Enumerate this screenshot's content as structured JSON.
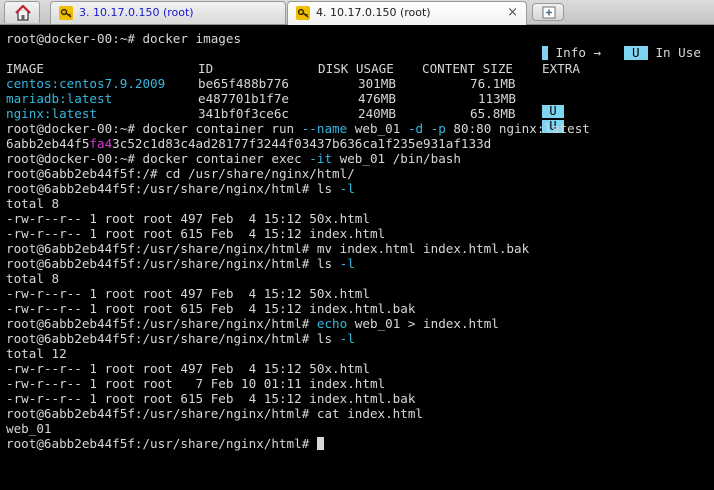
{
  "tabs": [
    {
      "label": "3. 10.17.0.150 (root)",
      "active": false
    },
    {
      "label": "4. 10.17.0.150 (root)",
      "active": true,
      "close": "×"
    }
  ],
  "colors": {
    "background": "#000000",
    "text": "#d7d7d7",
    "cyan": "#36b7e0",
    "badge": "#7fd4ef"
  },
  "legend": {
    "info": "Info →",
    "in_use_box": "U",
    "in_use_label": "In Use"
  },
  "terminal": {
    "line1": "root@docker-00:~# docker images",
    "header": {
      "repo": "IMAGE",
      "id": "ID",
      "disk": "DISK USAGE",
      "content": "CONTENT SIZE",
      "extra": "EXTRA"
    },
    "images": [
      {
        "name": "centos:centos7.9.2009",
        "id": "be65f488b776",
        "disk": "301MB",
        "content": "76.1MB",
        "extra": "U"
      },
      {
        "name": "mariadb:latest",
        "id": "e487701b1f7e",
        "disk": "476MB",
        "content": "113MB",
        "extra": "U"
      },
      {
        "name": "nginx:latest",
        "id": "341bf0f3ce6c",
        "disk": "240MB",
        "content": "65.8MB",
        "extra": ""
      }
    ],
    "run_prompt": "root@docker-00:~# ",
    "run_cmd": "docker container run ",
    "run_flag_name": "--name",
    "run_mid": " web_01 ",
    "run_flag_d": "-d",
    "run_sp": " ",
    "run_flag_p": "-p",
    "run_tail": " 80:80 nginx:latest",
    "hash_a": "6abb2eb44f5",
    "hash_b": "fa4",
    "hash_c": "3c52c1d83c4ad28177f3244f03437b636ca1f235e931af133d",
    "exec_prompt": "root@docker-00:~# ",
    "exec_cmd": "docker container exec ",
    "exec_flag": "-it",
    "exec_tail": " web_01 /bin/bash",
    "cd_line": "root@6abb2eb44f5f:/# cd /usr/share/nginx/html/",
    "ls1_prompt": "root@6abb2eb44f5f:/usr/share/nginx/html# ls ",
    "ls_flag": "-l",
    "total1": "total 8",
    "ls1_a": "-rw-r--r-- 1 root root 497 Feb  4 15:12 50x.html",
    "ls1_b": "-rw-r--r-- 1 root root 615 Feb  4 15:12 index.html",
    "mv_line": "root@6abb2eb44f5f:/usr/share/nginx/html# mv index.html index.html.bak",
    "ls2_prompt": "root@6abb2eb44f5f:/usr/share/nginx/html# ls ",
    "total2": "total 8",
    "ls2_a": "-rw-r--r-- 1 root root 497 Feb  4 15:12 50x.html",
    "ls2_b": "-rw-r--r-- 1 root root 615 Feb  4 15:12 index.html.bak",
    "echo_prompt": "root@6abb2eb44f5f:/usr/share/nginx/html# ",
    "echo_cmd": "echo",
    "echo_tail": " web_01 > index.html",
    "ls3_prompt": "root@6abb2eb44f5f:/usr/share/nginx/html# ls ",
    "total3": "total 12",
    "ls3_a": "-rw-r--r-- 1 root root 497 Feb  4 15:12 50x.html",
    "ls3_b": "-rw-r--r-- 1 root root   7 Feb 10 01:11 index.html",
    "ls3_c": "-rw-r--r-- 1 root root 615 Feb  4 15:12 index.html.bak",
    "cat_line": "root@6abb2eb44f5f:/usr/share/nginx/html# cat index.html",
    "cat_out": "web_01",
    "final_prompt": "root@6abb2eb44f5f:/usr/share/nginx/html# "
  }
}
